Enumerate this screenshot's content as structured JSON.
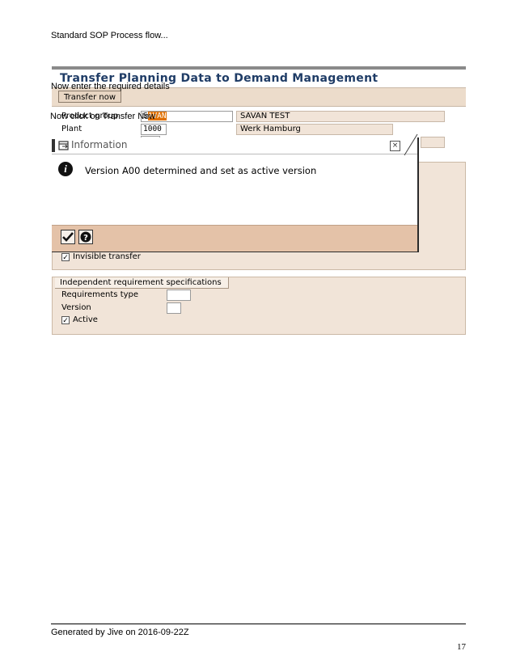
{
  "document": {
    "header": "Standard SOP Process flow...",
    "footer": "Generated by Jive on 2016-09-22Z",
    "page_number": "17"
  },
  "overlay": {
    "instruction_1": "Now enter the required details",
    "instruction_2": "Now click on Transfer Now"
  },
  "sap_screen": {
    "title": "Transfer Planning Data to Demand Management",
    "transfer_button": "Transfer now",
    "fields": {
      "product_group": {
        "label": "Product group",
        "value_prefix": "S",
        "value_highlight": "AVAN",
        "description": "SAVAN TEST"
      },
      "plant": {
        "label": "Plant",
        "value": "1000",
        "description": "Werk Hamburg"
      }
    },
    "invisible_transfer": {
      "label": "Invisible transfer",
      "checked": true
    },
    "independent_requirement": {
      "group_title": "Independent requirement specifications",
      "requirements_type_label": "Requirements type",
      "requirements_type_value": "",
      "version_label": "Version",
      "version_value": "",
      "active_label": "Active",
      "active_checked": true
    }
  },
  "dialog": {
    "title": "Information",
    "message": "Version A00 determined and set as active version",
    "close_glyph": "×",
    "info_glyph": "i",
    "ok_icon": "checkmark-icon",
    "help_icon": "help-icon"
  },
  "colors": {
    "title_blue": "#1f3c66",
    "highlight_orange": "#e07000",
    "panel_beige": "#f1e4d8",
    "dialog_footer": "#e4c2a8"
  }
}
